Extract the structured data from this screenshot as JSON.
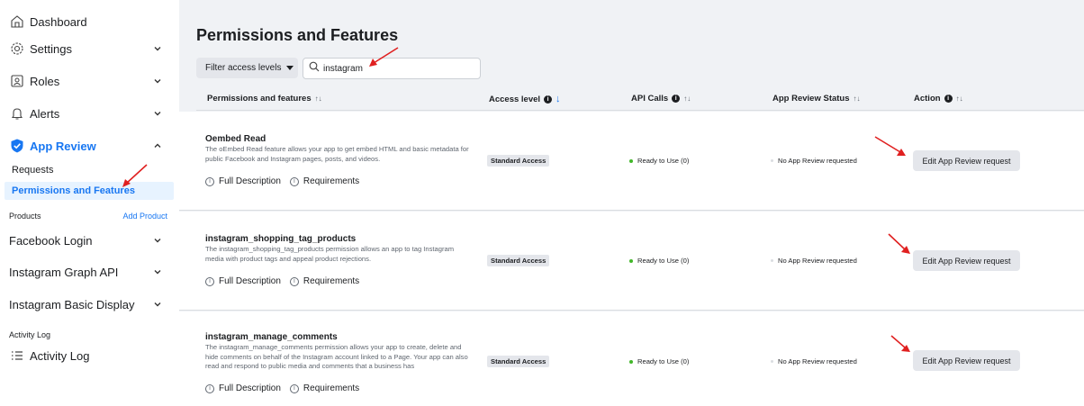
{
  "sidebar": {
    "dashboard": "Dashboard",
    "settings": "Settings",
    "roles": "Roles",
    "alerts": "Alerts",
    "app_review": "App Review",
    "requests": "Requests",
    "permissions": "Permissions and Features",
    "products_label": "Products",
    "add_product": "Add Product",
    "facebook_login": "Facebook Login",
    "instagram_graph": "Instagram Graph API",
    "instagram_basic": "Instagram Basic Display",
    "activity_label": "Activity Log",
    "activity_log": "Activity Log"
  },
  "main": {
    "title": "Permissions and Features",
    "filter_label": "Filter access levels",
    "search_value": "instagram",
    "columns": {
      "permissions": "Permissions and features",
      "access": "Access level",
      "api": "API Calls",
      "review": "App Review Status",
      "action": "Action"
    },
    "rows": [
      {
        "name": "Oembed Read",
        "desc": "The oEmbed Read feature allows your app to get embed HTML and basic metadata for public Facebook and Instagram pages, posts, and videos.",
        "full": "Full Description",
        "req": "Requirements",
        "access": "Standard Access",
        "api": "Ready to Use (0)",
        "review": "No App Review requested",
        "action": "Edit App Review request"
      },
      {
        "name": "instagram_shopping_tag_products",
        "desc": "The instagram_shopping_tag_products permission allows an app to tag Instagram media with product tags and appeal product rejections.",
        "full": "Full Description",
        "req": "Requirements",
        "access": "Standard Access",
        "api": "Ready to Use (0)",
        "review": "No App Review requested",
        "action": "Edit App Review request"
      },
      {
        "name": "instagram_manage_comments",
        "desc": "The instagram_manage_comments permission allows your app to create, delete and hide comments on behalf of the Instagram account linked to a Page. Your app can also read and respond to public media and comments that a business has",
        "full": "Full Description",
        "req": "Requirements",
        "access": "Standard Access",
        "api": "Ready to Use (0)",
        "review": "No App Review requested",
        "action": "Edit App Review request"
      }
    ]
  },
  "colors": {
    "accent": "#1877f2",
    "annotation_arrow": "#e02020",
    "ready": "#42b72a"
  }
}
